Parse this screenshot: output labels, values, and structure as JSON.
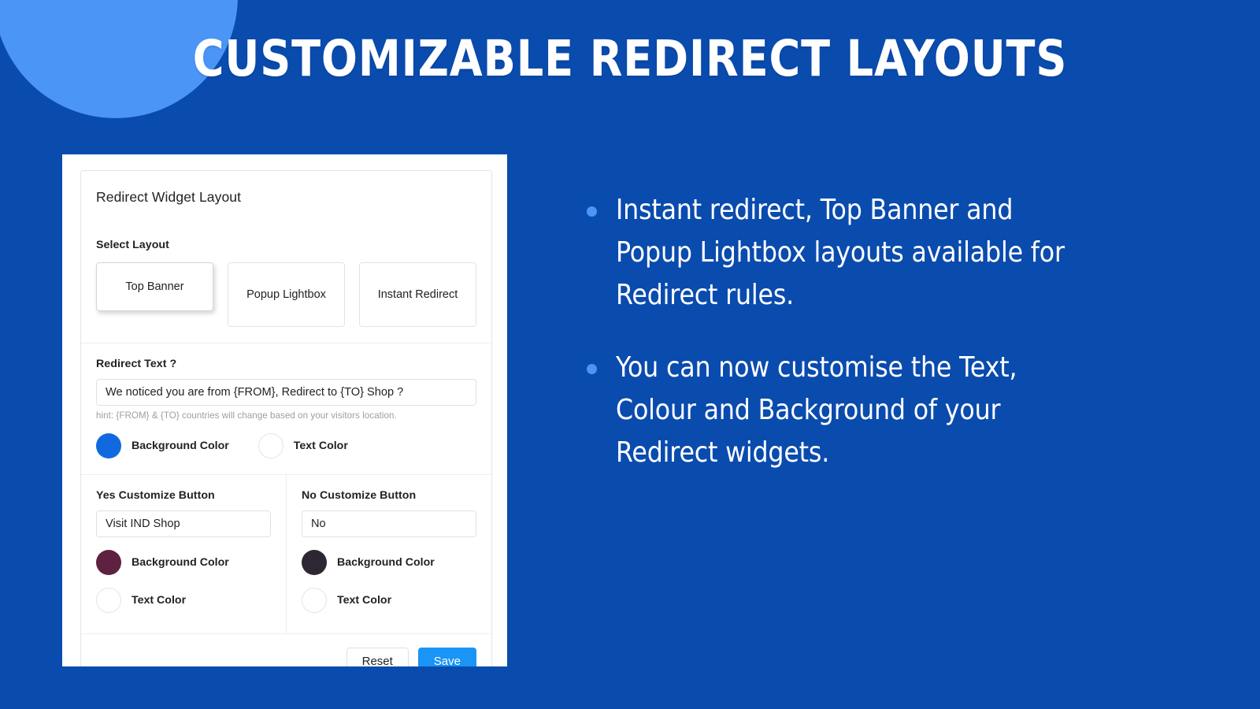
{
  "page": {
    "title": "CUSTOMIZABLE REDIRECT LAYOUTS",
    "background_color": "#0a4bae",
    "accent_circle_color": "#4b95f7"
  },
  "widget": {
    "header": "Redirect Widget Layout",
    "select_layout": {
      "label": "Select Layout",
      "options": [
        {
          "label": "Top Banner",
          "selected": true
        },
        {
          "label": "Popup Lightbox",
          "selected": false
        },
        {
          "label": "Instant Redirect",
          "selected": false
        }
      ]
    },
    "redirect_text": {
      "label": "Redirect Text ?",
      "value": "We noticed you are from {FROM}, Redirect to {TO} Shop ?",
      "placeholder": "We noticed you are from {FROM}, Redirect to {TO} Shop ?",
      "hint": "hint: {FROM} & {TO} countries will change based on your visitors location.",
      "background_color_label": "Background Color",
      "background_color_value": "#1169e0",
      "text_color_label": "Text Color",
      "text_color_value": "#ffffff"
    },
    "yes_button": {
      "label": "Yes Customize Button",
      "value": "Visit IND Shop",
      "placeholder": "Visit IND Shop",
      "background_color_label": "Background Color",
      "background_color_value": "#5e2140",
      "text_color_label": "Text Color",
      "text_color_value": "#ffffff"
    },
    "no_button": {
      "label": "No Customize Button",
      "value": "No",
      "placeholder": "No",
      "background_color_label": "Background Color",
      "background_color_value": "#2d2733",
      "text_color_label": "Text Color",
      "text_color_value": "#ffffff"
    },
    "footer": {
      "reset_label": "Reset",
      "save_label": "Save",
      "save_color": "#1a94f5"
    }
  },
  "bullets": [
    "Instant redirect, Top Banner and Popup Lightbox layouts available for Redirect rules.",
    "You can now customise the Text, Colour and Background of your Redirect widgets."
  ]
}
